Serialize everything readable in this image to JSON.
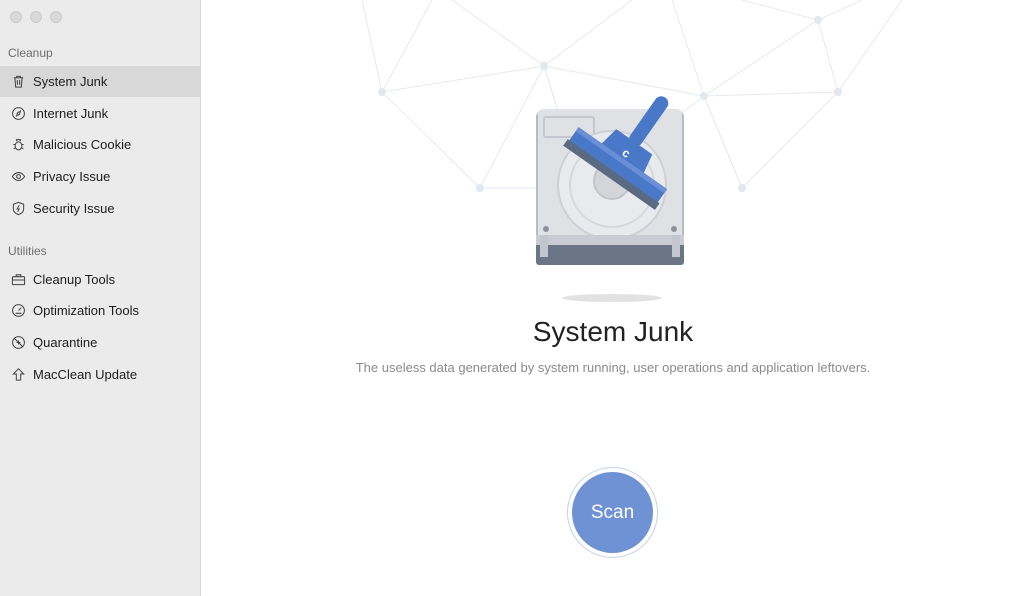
{
  "sidebar": {
    "sections": [
      {
        "label": "Cleanup",
        "items": [
          {
            "label": "System Junk",
            "icon": "trash-icon",
            "active": true
          },
          {
            "label": "Internet Junk",
            "icon": "compass-icon",
            "active": false
          },
          {
            "label": "Malicious Cookie",
            "icon": "bug-icon",
            "active": false
          },
          {
            "label": "Privacy Issue",
            "icon": "eye-icon",
            "active": false
          },
          {
            "label": "Security Issue",
            "icon": "shield-icon",
            "active": false
          }
        ]
      },
      {
        "label": "Utilities",
        "items": [
          {
            "label": "Cleanup Tools",
            "icon": "toolbox-icon",
            "active": false
          },
          {
            "label": "Optimization Tools",
            "icon": "gauge-icon",
            "active": false
          },
          {
            "label": "Quarantine",
            "icon": "quarantine-icon",
            "active": false
          },
          {
            "label": "MacClean Update",
            "icon": "upload-arrow-icon",
            "active": false
          }
        ]
      }
    ]
  },
  "main": {
    "title": "System Junk",
    "subtitle": "The useless data generated by system running, user operations and application leftovers.",
    "scan_label": "Scan",
    "illustration_icon": "hard-drive-broom-icon"
  },
  "colors": {
    "accent": "#6e92d3",
    "sidebar_bg": "#ebebeb",
    "active_item_bg": "#d8d8d8",
    "broom_blue": "#4a78c9"
  }
}
